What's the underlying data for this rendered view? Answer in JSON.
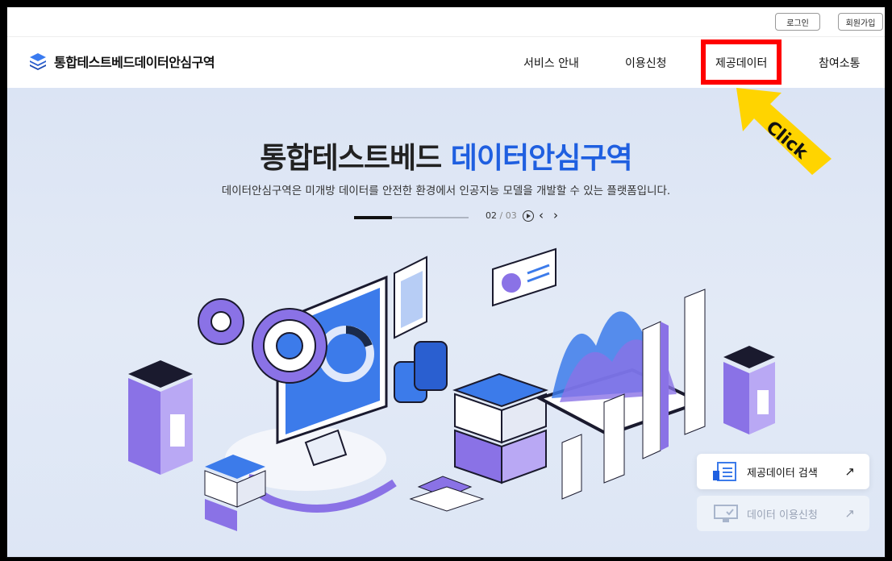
{
  "topbar": {
    "login": "로그인",
    "signup": "회원가입"
  },
  "logo": {
    "prefix": "통합테스트베드",
    "suffix": "데이터안심구역"
  },
  "nav": {
    "items": [
      "서비스 안내",
      "이용신청",
      "제공데이터",
      "참여소통"
    ]
  },
  "hero": {
    "title_main": "통합테스트베드",
    "title_accent": "데이터안심구역",
    "subtitle": "데이터안심구역은 미개방 데이터를 안전한 환경에서 인공지능 모델을 개발할 수 있는 플랫폼입니다.",
    "pager": {
      "current": "02",
      "separator": "/",
      "total": "03"
    },
    "slide_progress": 0.33
  },
  "cards": [
    {
      "label": "제공데이터 검색",
      "arrow": "↗",
      "icon": "document-list-icon"
    },
    {
      "label": "데이터 이용신청",
      "arrow": "↗",
      "icon": "monitor-check-icon"
    }
  ],
  "annotation": {
    "click_label": "Click"
  },
  "colors": {
    "accent": "#1f5fe0",
    "highlight": "#ff0000",
    "badge": "#ffd400"
  }
}
